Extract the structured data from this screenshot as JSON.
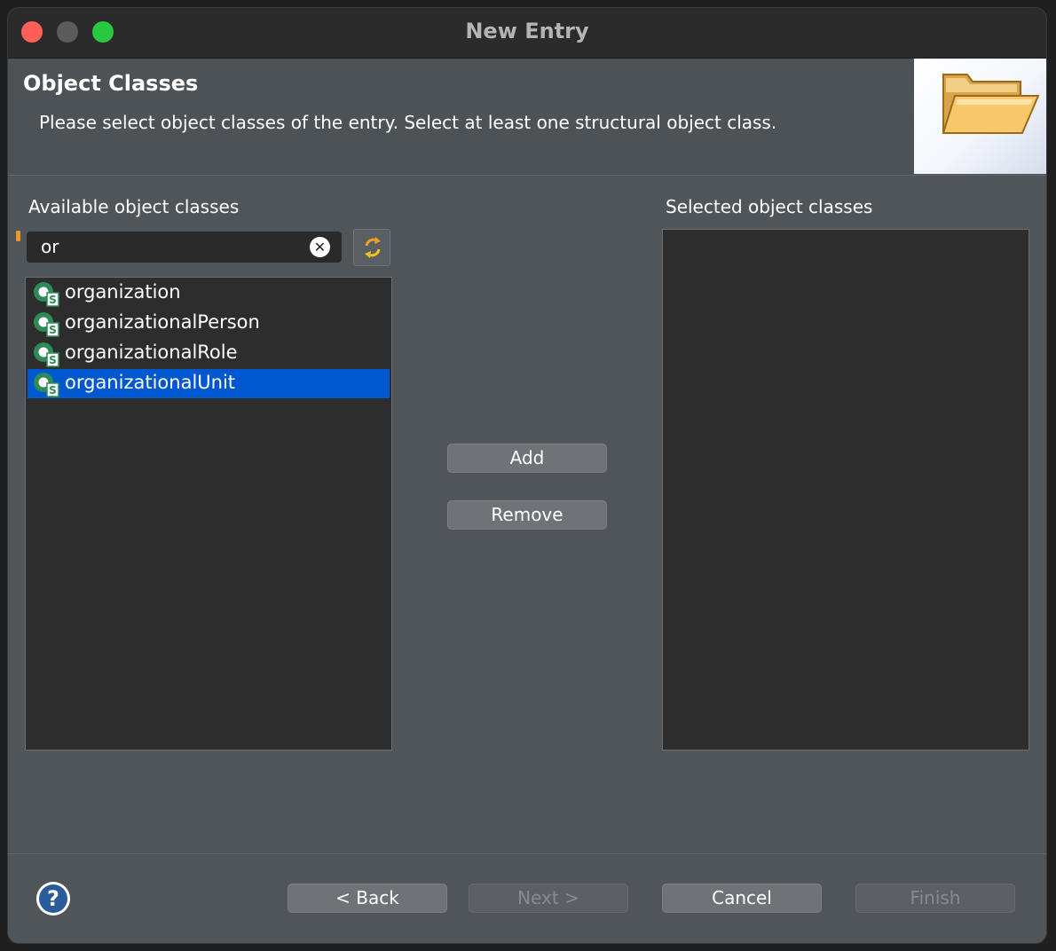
{
  "window": {
    "title": "New Entry"
  },
  "header": {
    "title": "Object Classes",
    "description": "Please select object classes of the entry. Select at least one structural object class."
  },
  "available": {
    "label": "Available object classes",
    "filter_value": "or",
    "items": [
      {
        "label": "organization",
        "selected": false
      },
      {
        "label": "organizationalPerson",
        "selected": false
      },
      {
        "label": "organizationalRole",
        "selected": false
      },
      {
        "label": "organizationalUnit",
        "selected": true
      }
    ]
  },
  "selected": {
    "label": "Selected object classes",
    "items": []
  },
  "actions": {
    "add_label": "Add",
    "remove_label": "Remove"
  },
  "footer": {
    "back_label": "< Back",
    "next_label": "Next >",
    "cancel_label": "Cancel",
    "finish_label": "Finish",
    "next_enabled": false,
    "finish_enabled": false
  },
  "colors": {
    "window_bg": "#50555a",
    "list_bg": "#2d2d2d",
    "selection": "#0058d0",
    "titlebar": "#2b2b2b"
  },
  "icons": {
    "list_item": "object-class-icon",
    "refresh": "refresh-icon",
    "clear": "clear-icon",
    "help": "help-icon",
    "header": "folder-icon"
  }
}
